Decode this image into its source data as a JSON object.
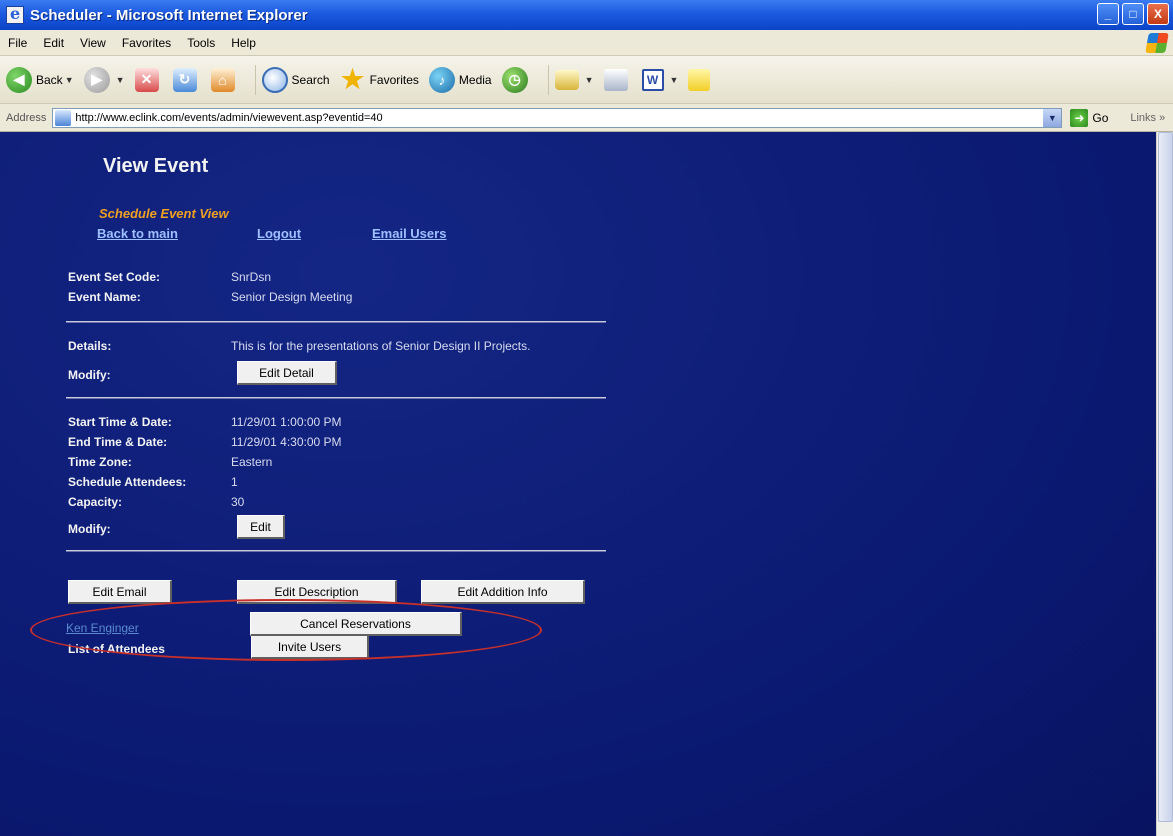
{
  "window": {
    "title": "Scheduler - Microsoft Internet Explorer",
    "controls": [
      "_",
      "□",
      "X"
    ]
  },
  "menu": [
    "File",
    "Edit",
    "View",
    "Favorites",
    "Tools",
    "Help"
  ],
  "toolbar": {
    "back": "Back",
    "search": "Search",
    "favorites": "Favorites",
    "media": "Media",
    "word_icon": "W"
  },
  "address": {
    "label": "Address",
    "url": "http://www.eclink.com/events/admin/viewevent.asp?eventid=40",
    "go": "Go",
    "links": "Links »"
  },
  "page": {
    "title": "View Event",
    "subtitle": "Schedule Event View",
    "nav": {
      "back_to_main": "Back to main",
      "logout": "Logout",
      "email_users": "Email Users"
    },
    "event": {
      "set_code_label": "Event Set Code:",
      "set_code": "SnrDsn",
      "name_label": "Event Name:",
      "name": "Senior Design Meeting"
    },
    "details": {
      "label": "Details:",
      "value": "This is for the presentations of Senior Design II Projects.",
      "modify_label": "Modify:",
      "edit_detail_button": "Edit Detail"
    },
    "schedule": {
      "start_label": "Start Time & Date:",
      "start": "11/29/01 1:00:00 PM",
      "end_label": "End Time & Date:",
      "end": "11/29/01 4:30:00 PM",
      "tz_label": "Time Zone:",
      "tz": "Eastern",
      "attendees_label": "Schedule Attendees:",
      "attendees": "1",
      "capacity_label": "Capacity:",
      "capacity": "30",
      "modify_label": "Modify:",
      "edit_button": "Edit"
    },
    "actions": {
      "edit_email": "Edit Email",
      "edit_description": "Edit Description",
      "edit_addition_info": "Edit Addition Info"
    },
    "attendees": {
      "label": "List of Attendees",
      "invite_button": "Invite Users",
      "attendee_name": "Ken Enginger",
      "cancel_button": "Cancel Reservations"
    }
  },
  "colors": {
    "page_background": "#0b1a78",
    "subtitle": "#f0a020",
    "link": "#9ec0ff",
    "highlight": "#c8302a"
  }
}
